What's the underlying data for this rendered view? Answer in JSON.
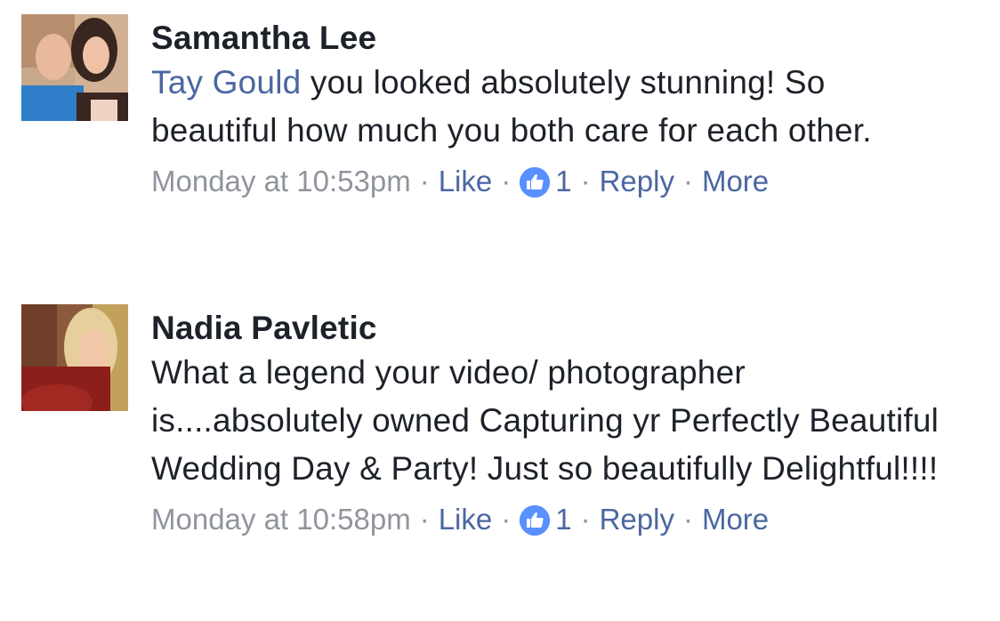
{
  "comments": [
    {
      "author": "Samantha Lee",
      "mention": "Tay Gould",
      "text_after_mention": " you looked absolutely stunning! So beautiful how much you both care for each other.",
      "timestamp": "Monday at 10:53pm",
      "like_label": "Like",
      "reaction_icon": "thumbs-up-icon",
      "reaction_count": "1",
      "reply_label": "Reply",
      "more_label": "More"
    },
    {
      "author": "Nadia Pavletic",
      "mention": "",
      "text_after_mention": "What a legend your video/ photographer is....absolutely owned Capturing yr Perfectly Beautiful Wedding Day & Party! Just so beautifully Delightful!!!!",
      "timestamp": "Monday at 10:58pm",
      "like_label": "Like",
      "reaction_icon": "thumbs-up-icon",
      "reaction_count": "1",
      "reply_label": "Reply",
      "more_label": "More"
    }
  ],
  "separator": "·",
  "colors": {
    "author": "#1d2129",
    "link": "#4b67a1",
    "meta": "#90949c",
    "like_badge": "#5890ff"
  }
}
